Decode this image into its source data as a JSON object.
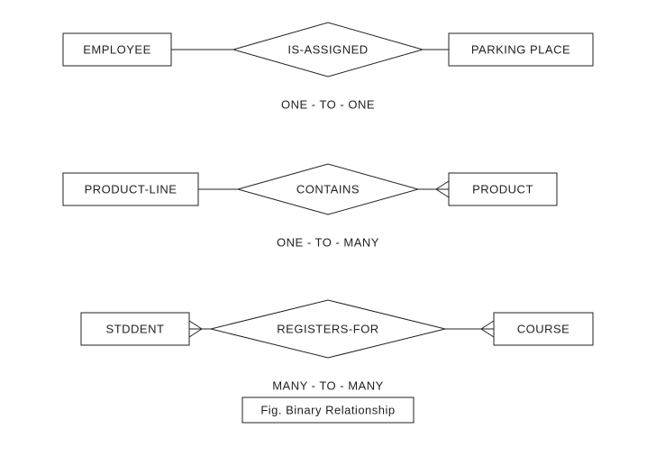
{
  "rows": [
    {
      "left_entity": "EMPLOYEE",
      "relationship": "IS-ASSIGNED",
      "right_entity": "PARKING PLACE",
      "left_crow": false,
      "right_crow": false,
      "cardinality": "ONE - TO - ONE"
    },
    {
      "left_entity": "PRODUCT-LINE",
      "relationship": "CONTAINS",
      "right_entity": "PRODUCT",
      "left_crow": false,
      "right_crow": true,
      "cardinality": "ONE - TO - MANY"
    },
    {
      "left_entity": "STDDENT",
      "relationship": "REGISTERS-FOR",
      "right_entity": "COURSE",
      "left_crow": true,
      "right_crow": true,
      "cardinality": "MANY - TO - MANY"
    }
  ],
  "caption": "Fig. Binary Relationship"
}
